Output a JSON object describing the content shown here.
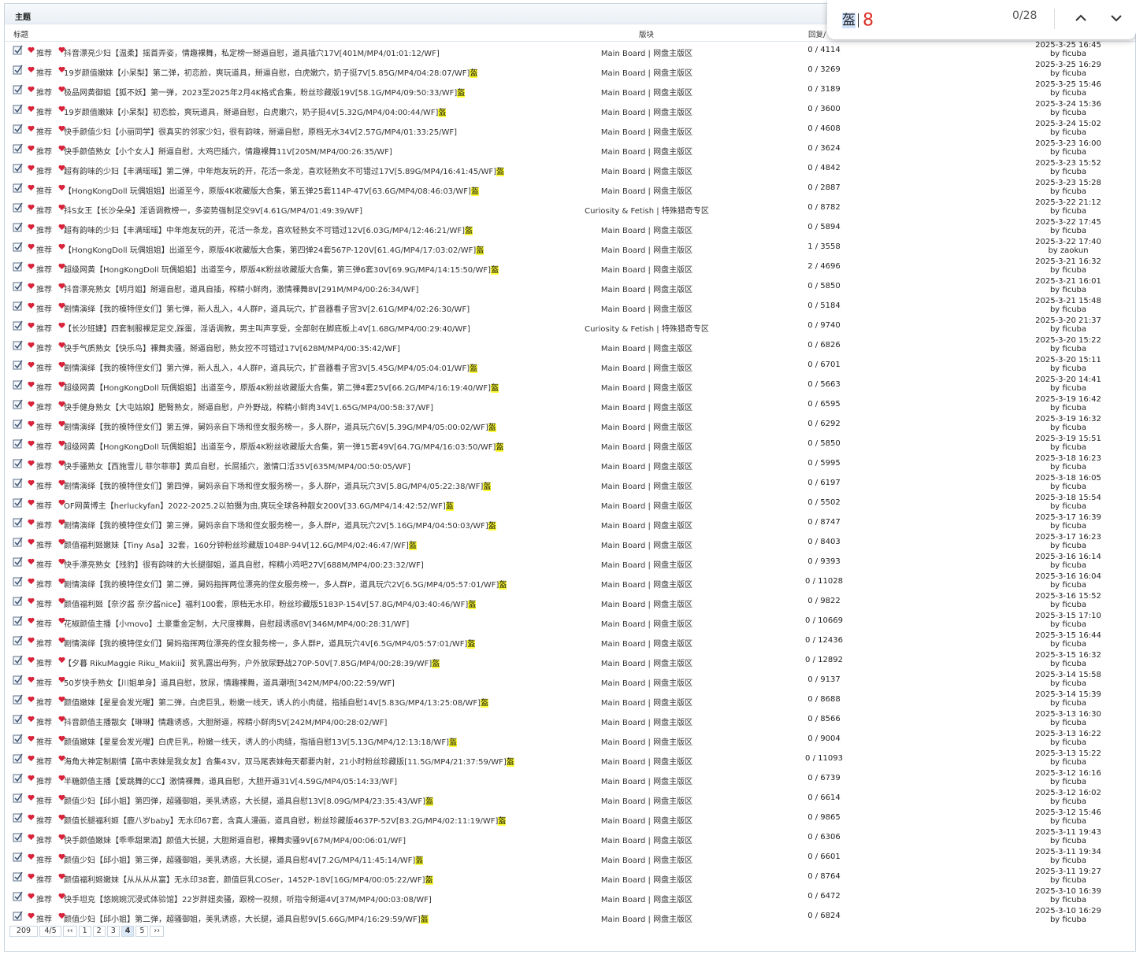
{
  "header": {
    "title": "主题"
  },
  "columns": {
    "title": "标题",
    "board": "版块",
    "reply": "回复/"
  },
  "tag_label": "推荐",
  "by_prefix": "by",
  "highlight_char": "盔",
  "rows": [
    {
      "title": "抖音漂亮少妇【温柔】摇首弄姿，情趣裸舞，私定榜一掰逼自慰，道具插穴17V[401M/MP4/01:01:12/WF]",
      "hl": false,
      "board": "Main Board | 网盘主版区",
      "reply": "0 / 4114",
      "date": "2025-3-25 16:45",
      "user": "ficuba"
    },
    {
      "title": "19岁颜值嫩妹【小呆梨】第二弹，初恋脸，爽玩道具，掰逼自慰，白虎嫩穴，奶子挺7V[5.85G/MP4/04:28:07/WF]",
      "hl": true,
      "board": "Main Board | 网盘主版区",
      "reply": "0 / 3269",
      "date": "2025-3-25 16:29",
      "user": "ficuba"
    },
    {
      "title": "极品网黄御姐【狐不妖】第一弹，2023至2025年2月4K格式合集，粉丝珍藏版19V[58.1G/MP4/09:50:33/WF]",
      "hl": true,
      "board": "Main Board | 网盘主版区",
      "reply": "0 / 3189",
      "date": "2025-3-25 15:46",
      "user": "ficuba"
    },
    {
      "title": "19岁颜值嫩妹【小呆梨】初恋脸，爽玩道具，掰逼自慰，白虎嫩穴，奶子挺4V[5.32G/MP4/04:00:44/WF]",
      "hl": true,
      "board": "Main Board | 网盘主版区",
      "reply": "0 / 3600",
      "date": "2025-3-24 15:36",
      "user": "ficuba"
    },
    {
      "title": "快手颜值少妇【小丽同学】很真实的邻家少妇，很有韵味，掰逼自慰，原档无水34V[2.57G/MP4/01:33:25/WF]",
      "hl": false,
      "board": "Main Board | 网盘主版区",
      "reply": "0 / 4608",
      "date": "2025-3-24 15:02",
      "user": "ficuba"
    },
    {
      "title": "快手颜值熟女【小个女人】掰逼自慰，大鸡巴插穴，情趣裸舞11V[205M/MP4/00:26:35/WF]",
      "hl": false,
      "board": "Main Board | 网盘主版区",
      "reply": "0 / 3624",
      "date": "2025-3-23 16:00",
      "user": "ficuba"
    },
    {
      "title": "超有韵味的少妇【丰满瑶瑶】第二弹，中年炮友玩的开，花活一条龙，喜欢轻熟女不可错过17V[5.89G/MP4/16:41:45/WF]",
      "hl": true,
      "board": "Main Board | 网盘主版区",
      "reply": "0 / 4842",
      "date": "2025-3-23 15:52",
      "user": "ficuba"
    },
    {
      "title": "【HongKongDoll 玩偶姐姐】出道至今，原版4K收藏版大合集，第五弹25套114P-47V[63.6G/MP4/08:46:03/WF]",
      "hl": true,
      "board": "Main Board | 网盘主版区",
      "reply": "0 / 2887",
      "date": "2025-3-23 15:28",
      "user": "ficuba"
    },
    {
      "title": "抖S女王【长沙朵朵】淫语调教榜一，多姿势强制足交9V[4.61G/MP4/01:49:39/WF]",
      "hl": false,
      "board": "Curiosity & Fetish | 特殊猎奇专区",
      "reply": "0 / 8782",
      "date": "2025-3-22 21:12",
      "user": "ficuba"
    },
    {
      "title": "超有韵味的少妇【丰满瑶瑶】中年炮友玩的开，花活一条龙，喜欢轻熟女不可错过12V[6.03G/MP4/12:46:21/WF]",
      "hl": true,
      "board": "Main Board | 网盘主版区",
      "reply": "0 / 5894",
      "date": "2025-3-22 17:45",
      "user": "ficuba"
    },
    {
      "title": "【HongKongDoll 玩偶姐姐】出道至今，原版4K收藏版大合集，第四弹24套567P-120V[61.4G/MP4/17:03:02/WF]",
      "hl": true,
      "board": "Main Board | 网盘主版区",
      "reply": "1 / 3558",
      "date": "2025-3-22 17:40",
      "user": "zaokun"
    },
    {
      "title": "超级网黄【HongKongDoll 玩偶姐姐】出道至今，原版4K粉丝收藏版大合集，第三弹6套30V[69.9G/MP4/14:15:50/WF]",
      "hl": true,
      "board": "Main Board | 网盘主版区",
      "reply": "2 / 4696",
      "date": "2025-3-21 16:32",
      "user": "ficuba"
    },
    {
      "title": "抖音漂亮熟女【明月姐】掰逼自慰，道具自插，榨精小鲜肉，激情裸舞8V[291M/MP4/00:26:34/WF]",
      "hl": false,
      "board": "Main Board | 网盘主版区",
      "reply": "0 / 5850",
      "date": "2025-3-21 16:01",
      "user": "ficuba"
    },
    {
      "title": "剧情演绎【我的模特侄女们】第七弹，新人乱入，4人群P，道具玩穴，扩音器看子宫3V[2.61G/MP4/02:26:30/WF]",
      "hl": false,
      "board": "Main Board | 网盘主版区",
      "reply": "0 / 5184",
      "date": "2025-3-21 15:48",
      "user": "ficuba"
    },
    {
      "title": "【长沙班婕】四套制服裸足足交,踩蛋，淫语调教，男主叫声享受，全部射在脚底板上4V[1.68G/MP4/00:29:40/WF]",
      "hl": false,
      "board": "Curiosity & Fetish | 特殊猎奇专区",
      "reply": "0 / 9740",
      "date": "2025-3-20 21:37",
      "user": "ficuba"
    },
    {
      "title": "快手气质熟女【快乐鸟】裸舞卖骚，掰逼自慰，熟女控不可错过17V[628M/MP4/00:35:42/WF]",
      "hl": false,
      "board": "Main Board | 网盘主版区",
      "reply": "0 / 6826",
      "date": "2025-3-20 15:22",
      "user": "ficuba"
    },
    {
      "title": "剧情演绎【我的模特侄女们】第六弹，新人乱入，4人群P，道具玩穴，扩音器看子宫3V[5.45G/MP4/05:04:01/WF]",
      "hl": true,
      "board": "Main Board | 网盘主版区",
      "reply": "0 / 6701",
      "date": "2025-3-20 15:11",
      "user": "ficuba"
    },
    {
      "title": "超级网黄【HongKongDoll 玩偶姐姐】出道至今，原版4K粉丝收藏版大合集，第二弹4套25V[66.2G/MP4/16:19:40/WF]",
      "hl": true,
      "board": "Main Board | 网盘主版区",
      "reply": "0 / 5663",
      "date": "2025-3-20 14:41",
      "user": "ficuba"
    },
    {
      "title": "快手健身熟女【大屯姑娘】肥臀熟女，掰逼自慰，户外野战，榨精小鲜肉34V[1.65G/MP4/00:58:37/WF]",
      "hl": false,
      "board": "Main Board | 网盘主版区",
      "reply": "0 / 6595",
      "date": "2025-3-19 16:42",
      "user": "ficuba"
    },
    {
      "title": "剧情演绎【我的模特侄女们】第五弹，舅妈亲自下场和侄女服务榜一，多人群P，道具玩穴6V[5.39G/MP4/05:00:02/WF]",
      "hl": true,
      "board": "Main Board | 网盘主版区",
      "reply": "0 / 6292",
      "date": "2025-3-19 16:32",
      "user": "ficuba"
    },
    {
      "title": "超级网黄【HongKongDoll 玩偶姐姐】出道至今，原版4K粉丝收藏版大合集，第一弹15套49V[64.7G/MP4/16:03:50/WF]",
      "hl": true,
      "board": "Main Board | 网盘主版区",
      "reply": "0 / 5850",
      "date": "2025-3-19 15:51",
      "user": "ficuba"
    },
    {
      "title": "快手骚熟女【西施雪儿 菲尔菲菲】黄瓜自慰，长屌插穴，激情口活35V[635M/MP4/00:50:05/WF]",
      "hl": false,
      "board": "Main Board | 网盘主版区",
      "reply": "0 / 5995",
      "date": "2025-3-18 16:23",
      "user": "ficuba"
    },
    {
      "title": "剧情演绎【我的模特侄女们】第四弹，舅妈亲自下场和侄女服务榜一，多人群P，道具玩穴3V[5.8G/MP4/05:22:38/WF]",
      "hl": true,
      "board": "Main Board | 网盘主版区",
      "reply": "0 / 6197",
      "date": "2025-3-18 16:05",
      "user": "ficuba"
    },
    {
      "title": "OF网黄博主【herluckyfan】2022-2025.2以拍摄为由,爽玩全球各种靓女200V[33.6G/MP4/14:42:52/WF]",
      "hl": true,
      "board": "Main Board | 网盘主版区",
      "reply": "0 / 5502",
      "date": "2025-3-18 15:54",
      "user": "ficuba"
    },
    {
      "title": "剧情演绎【我的模特侄女们】第三弹，舅妈亲自下场和侄女服务榜一，多人群P，道具玩穴2V[5.16G/MP4/04:50:03/WF]",
      "hl": true,
      "board": "Main Board | 网盘主版区",
      "reply": "0 / 8747",
      "date": "2025-3-17 16:39",
      "user": "ficuba"
    },
    {
      "title": "颜值福利姬嫩妹【Tiny Asa】32套，160分钟粉丝珍藏版1048P-94V[12.6G/MP4/02:46:47/WF]",
      "hl": true,
      "board": "Main Board | 网盘主版区",
      "reply": "0 / 8403",
      "date": "2025-3-17 16:23",
      "user": "ficuba"
    },
    {
      "title": "快手漂亮熟女【残豹】很有韵味的大长腿御姐，道具自慰，榨精小鸡吧27V[688M/MP4/00:23:32/WF]",
      "hl": false,
      "board": "Main Board | 网盘主版区",
      "reply": "0 / 9393",
      "date": "2025-3-16 16:14",
      "user": "ficuba"
    },
    {
      "title": "剧情演绎【我的模特侄女们】第二弹，舅妈指挥两位漂亮的侄女服务榜一，多人群P，道具玩穴2V[6.5G/MP4/05:57:01/WF]",
      "hl": true,
      "board": "Main Board | 网盘主版区",
      "reply": "0 / 11028",
      "date": "2025-3-16 16:04",
      "user": "ficuba"
    },
    {
      "title": "颜值福利姬【奈汐酱 奈汐酱nice】福利100套，原档无水印，粉丝珍藏版5183P-154V[57.8G/MP4/03:40:46/WF]",
      "hl": true,
      "board": "Main Board | 网盘主版区",
      "reply": "0 / 9822",
      "date": "2025-3-16 15:52",
      "user": "ficuba"
    },
    {
      "title": "花椒颜值主播【小movo】土豪重金定制，大尺度裸舞，自慰超诱惑8V[346M/MP4/00:28:31/WF]",
      "hl": false,
      "board": "Main Board | 网盘主版区",
      "reply": "0 / 10669",
      "date": "2025-3-15 17:10",
      "user": "ficuba"
    },
    {
      "title": "剧情演绎【我的模特侄女们】舅妈指挥两位漂亮的侄女服务榜一，多人群P，道具玩穴4V[6.5G/MP4/05:57:01/WF]",
      "hl": true,
      "board": "Main Board | 网盘主版区",
      "reply": "0 / 12436",
      "date": "2025-3-15 16:44",
      "user": "ficuba"
    },
    {
      "title": "【夕暮 RikuMaggie Riku_Makiii】贫乳露出母狗，户外放尿野战270P-50V[7.85G/MP4/00:28:39/WF]",
      "hl": true,
      "board": "Main Board | 网盘主版区",
      "reply": "0 / 12892",
      "date": "2025-3-15 16:32",
      "user": "ficuba"
    },
    {
      "title": "50岁快手熟女【川姐单身】道具自慰，放尿，情趣裸舞，道具潮喷[342M/MP4/00:22:59/WF]",
      "hl": false,
      "board": "Main Board | 网盘主版区",
      "reply": "0 / 9137",
      "date": "2025-3-14 15:58",
      "user": "ficuba"
    },
    {
      "title": "颜值嫩妹【星星会发光喔】第二弹，白虎巨乳，粉嫩一线天，诱人的小肉缝，指插自慰14V[5.83G/MP4/13:25:08/WF]",
      "hl": true,
      "board": "Main Board | 网盘主版区",
      "reply": "0 / 8688",
      "date": "2025-3-14 15:39",
      "user": "ficuba"
    },
    {
      "title": "抖音颜值主播靓女【琳琳】情趣诱惑，大胆掰逼，榨精小鲜肉5V[242M/MP4/00:28:02/WF]",
      "hl": false,
      "board": "Main Board | 网盘主版区",
      "reply": "0 / 8566",
      "date": "2025-3-13 16:30",
      "user": "ficuba"
    },
    {
      "title": "颜值嫩妹【星星会发光喔】白虎巨乳，粉嫩一线天，诱人的小肉缝，指插自慰13V[5.13G/MP4/12:13:18/WF]",
      "hl": true,
      "board": "Main Board | 网盘主版区",
      "reply": "0 / 9004",
      "date": "2025-3-13 16:22",
      "user": "ficuba"
    },
    {
      "title": "海角大神定制剧情【高中表妹是我女友】合集43V，双马尾表妹每天都要内射，21小时粉丝珍藏版[11.5G/MP4/21:37:59/WF]",
      "hl": true,
      "board": "Main Board | 网盘主版区",
      "reply": "0 / 11093",
      "date": "2025-3-13 15:22",
      "user": "ficuba"
    },
    {
      "title": "半糖颜值主播【爱跳舞的CC】激情裸舞，道具自慰，大胆开逼31V[4.59G/MP4/05:14:33/WF]",
      "hl": false,
      "board": "Main Board | 网盘主版区",
      "reply": "0 / 6739",
      "date": "2025-3-12 16:16",
      "user": "ficuba"
    },
    {
      "title": "颜值少妇【邱小姐】第四弹，超骚御姐，美乳诱惑，大长腿，道具自慰13V[8.09G/MP4/23:35:43/WF]",
      "hl": true,
      "board": "Main Board | 网盘主版区",
      "reply": "0 / 6614",
      "date": "2025-3-12 16:02",
      "user": "ficuba"
    },
    {
      "title": "颜值长腿福利姬【鹿八岁baby】无水印67套，含真人漫画，道具自慰，粉丝珍藏版4637P-52V[83.2G/MP4/02:11:19/WF]",
      "hl": true,
      "board": "Main Board | 网盘主版区",
      "reply": "0 / 9865",
      "date": "2025-3-12 15:46",
      "user": "ficuba"
    },
    {
      "title": "快手颜值嫩妹【乖乖甜果酒】颜值大长腿，大胆掰逼自慰，裸舞卖骚9V[67M/MP4/00:06:01/WF]",
      "hl": false,
      "board": "Main Board | 网盘主版区",
      "reply": "0 / 6306",
      "date": "2025-3-11 19:43",
      "user": "ficuba"
    },
    {
      "title": "颜值少妇【邱小姐】第三弹，超骚御姐，美乳诱惑，大长腿，道具自慰4V[7.2G/MP4/11:45:14/WF]",
      "hl": true,
      "board": "Main Board | 网盘主版区",
      "reply": "0 / 6601",
      "date": "2025-3-11 19:34",
      "user": "ficuba"
    },
    {
      "title": "颜值福利姬嫩妹【从从从从富】无水印38套，颜值巨乳COSer，1452P-18V[16G/MP4/00:05:22/WF]",
      "hl": true,
      "board": "Main Board | 网盘主版区",
      "reply": "0 / 8764",
      "date": "2025-3-11 19:27",
      "user": "ficuba"
    },
    {
      "title": "快手坦克【悠婉婉沉浸式体验馆】22岁胖妞卖骚，跟榜一视频，听指令掰逼4V[37M/MP4/00:03:08/WF]",
      "hl": false,
      "board": "Main Board | 网盘主版区",
      "reply": "0 / 6472",
      "date": "2025-3-10 16:39",
      "user": "ficuba"
    },
    {
      "title": "颜值少妇【邱小姐】第二弹，超骚御姐，美乳诱惑，大长腿，道具自慰9V[5.66G/MP4/16:29:59/WF]",
      "hl": true,
      "board": "Main Board | 网盘主版区",
      "reply": "0 / 6824",
      "date": "2025-3-10 16:29",
      "user": "ficuba"
    }
  ],
  "pager": {
    "total": "209",
    "page_of": "4/5",
    "first": "‹‹",
    "pages": [
      "1",
      "2",
      "3",
      "4",
      "5"
    ],
    "current": "4",
    "next": "››"
  },
  "findbar": {
    "query": "盔",
    "typed": "8",
    "count": "0/28"
  },
  "colors": {
    "highlight": "#ffff38",
    "heart": "#d8233a",
    "find_typed": "#d93025"
  }
}
